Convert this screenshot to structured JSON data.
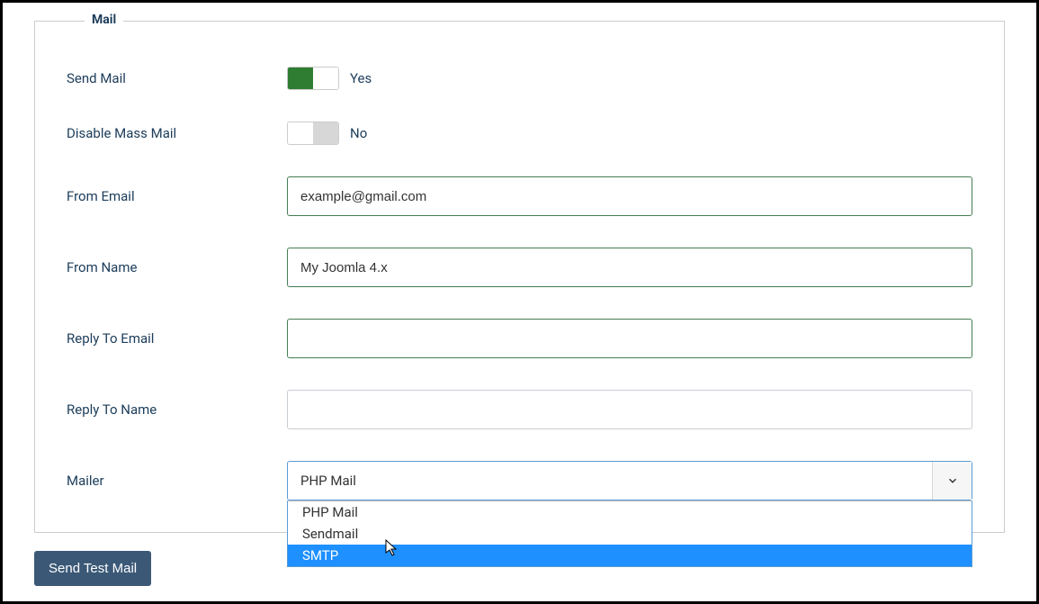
{
  "fieldset": {
    "legend": "Mail"
  },
  "rows": {
    "send_mail": {
      "label": "Send Mail",
      "value_text": "Yes"
    },
    "disable_mass": {
      "label": "Disable Mass Mail",
      "value_text": "No"
    },
    "from_email": {
      "label": "From Email",
      "value": "example@gmail.com"
    },
    "from_name": {
      "label": "From Name",
      "value": "My Joomla 4.x"
    },
    "reply_email": {
      "label": "Reply To Email",
      "value": ""
    },
    "reply_name": {
      "label": "Reply To Name",
      "value": ""
    },
    "mailer": {
      "label": "Mailer",
      "selected": "PHP Mail",
      "options": [
        "PHP Mail",
        "Sendmail",
        "SMTP"
      ],
      "highlighted": "SMTP"
    }
  },
  "buttons": {
    "send_test": "Send Test Mail"
  }
}
